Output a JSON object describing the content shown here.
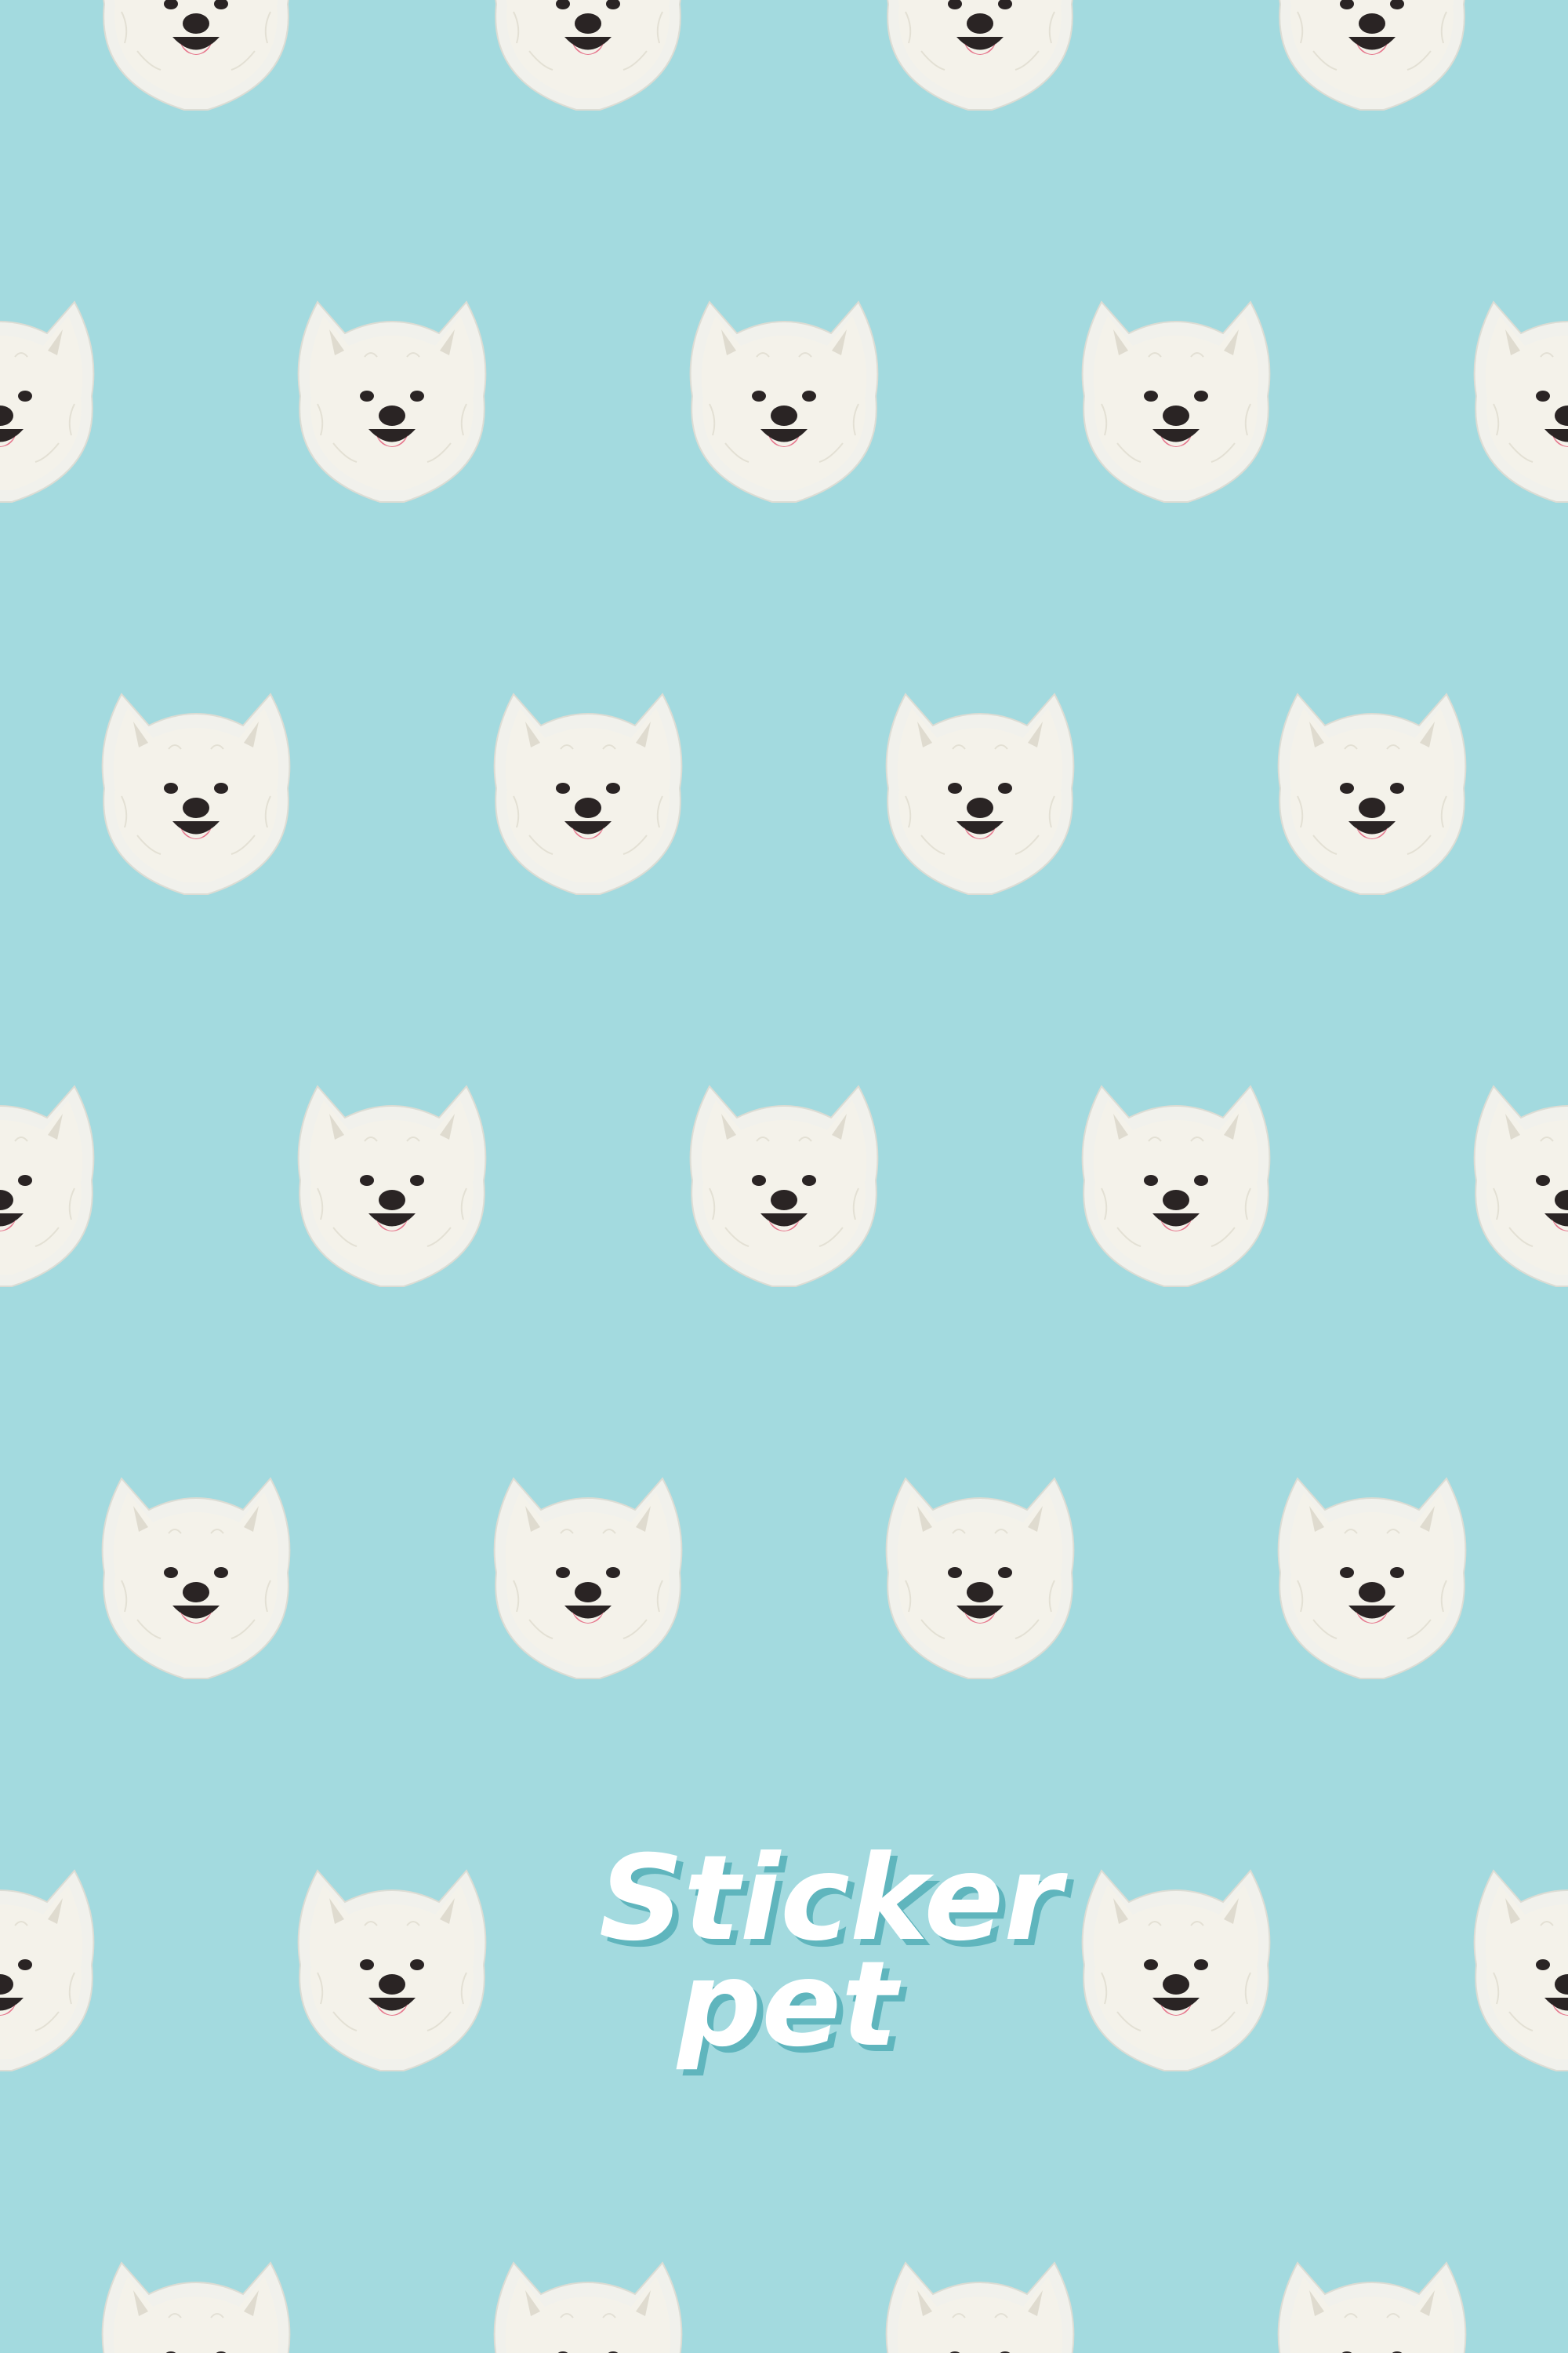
{
  "background_color": "#A3DADF",
  "sticker": {
    "icon": "samoyed-dog-face-sticker-icon",
    "outline_color": "#F1F1EC",
    "fur_color": "#F4F2EA",
    "fur_shadow_color": "#D6D2C3",
    "nose_color": "#2A2424",
    "tongue_color": "#E6788E"
  },
  "logo": {
    "icon": "sticker-pet-logo",
    "line1": "Sticker",
    "line2": "pet",
    "text_color": "#FFFFFF",
    "shadow_color": "#5FB5BD"
  }
}
